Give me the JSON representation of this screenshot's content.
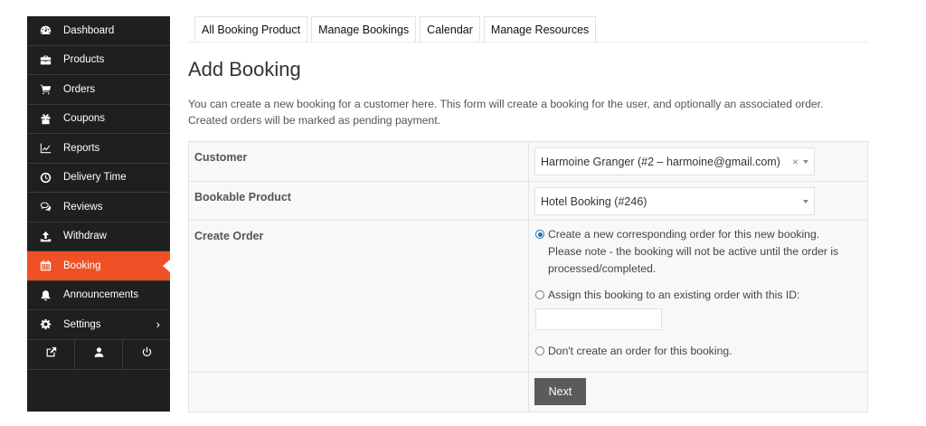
{
  "sidebar": {
    "items": [
      {
        "label": "Dashboard",
        "icon": "dashboard-icon"
      },
      {
        "label": "Products",
        "icon": "briefcase-icon"
      },
      {
        "label": "Orders",
        "icon": "cart-icon"
      },
      {
        "label": "Coupons",
        "icon": "gift-icon"
      },
      {
        "label": "Reports",
        "icon": "line-chart-icon"
      },
      {
        "label": "Delivery Time",
        "icon": "clock-icon"
      },
      {
        "label": "Reviews",
        "icon": "comments-icon"
      },
      {
        "label": "Withdraw",
        "icon": "upload-icon"
      },
      {
        "label": "Booking",
        "icon": "calendar-icon"
      },
      {
        "label": "Announcements",
        "icon": "bell-icon"
      },
      {
        "label": "Settings",
        "icon": "gear-icon"
      }
    ],
    "active_item": "Booking",
    "accent_color": "#f05025",
    "bottom_icons": [
      "external-link-icon",
      "user-icon",
      "power-icon"
    ]
  },
  "tabs": [
    {
      "label": "All Booking Product"
    },
    {
      "label": "Manage Bookings"
    },
    {
      "label": "Calendar"
    },
    {
      "label": "Manage Resources"
    }
  ],
  "page": {
    "title": "Add Booking",
    "description": "You can create a new booking for a customer here. This form will create a booking for the user, and optionally an associated order. Created orders will be marked as pending payment."
  },
  "form": {
    "customer": {
      "label": "Customer",
      "value": "Harmoine Granger (#2 – harmoine@gmail.com)"
    },
    "product": {
      "label": "Bookable Product",
      "value": "Hotel Booking (#246)"
    },
    "create_order": {
      "label": "Create Order",
      "options": [
        {
          "text": "Create a new corresponding order for this new booking. Please note - the booking will not be active until the order is processed/completed.",
          "checked": true
        },
        {
          "text": "Assign this booking to an existing order with this ID:",
          "checked": false
        },
        {
          "text": "Don't create an order for this booking.",
          "checked": false
        }
      ],
      "order_id_value": ""
    },
    "next_label": "Next"
  }
}
